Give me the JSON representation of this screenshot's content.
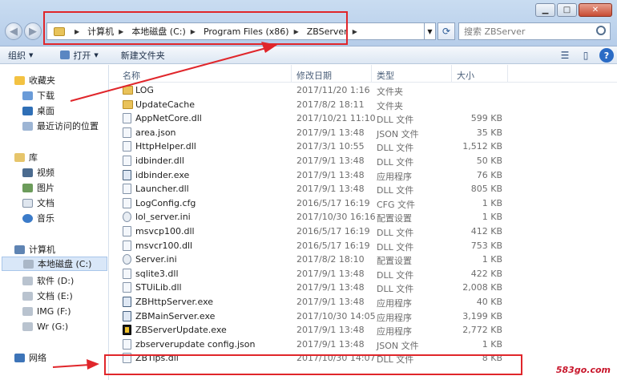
{
  "address": {
    "crumbs": [
      "计算机",
      "本地磁盘 (C:)",
      "Program Files (x86)",
      "ZBServer"
    ],
    "search_placeholder": "搜索 ZBServer"
  },
  "window_controls": {
    "minimize": "▁",
    "maximize": "□",
    "close": "✕"
  },
  "toolbar": {
    "organize": "组织",
    "open": "打开",
    "new_folder": "新建文件夹"
  },
  "nav": {
    "favorites": "收藏夹",
    "downloads": "下载",
    "desktop": "桌面",
    "recent": "最近访问的位置",
    "libraries": "库",
    "videos": "视频",
    "pictures": "图片",
    "documents": "文档",
    "music": "音乐",
    "computer": "计算机",
    "drive_c": "本地磁盘 (C:)",
    "drive_d": "软件 (D:)",
    "drive_e": "文档 (E:)",
    "drive_f": "IMG (F:)",
    "drive_g": "Wr (G:)",
    "network": "网络"
  },
  "columns": {
    "name": "名称",
    "date": "修改日期",
    "type": "类型",
    "size": "大小"
  },
  "files": [
    {
      "name": "LOG",
      "date": "2017/11/20 1:16",
      "type": "文件夹",
      "size": "",
      "icon": "folder"
    },
    {
      "name": "UpdateCache",
      "date": "2017/8/2 18:11",
      "type": "文件夹",
      "size": "",
      "icon": "folder"
    },
    {
      "name": "AppNetCore.dll",
      "date": "2017/10/21 11:10",
      "type": "DLL 文件",
      "size": "599 KB",
      "icon": "file"
    },
    {
      "name": "area.json",
      "date": "2017/9/1 13:48",
      "type": "JSON 文件",
      "size": "35 KB",
      "icon": "file"
    },
    {
      "name": "HttpHelper.dll",
      "date": "2017/3/1 10:55",
      "type": "DLL 文件",
      "size": "1,512 KB",
      "icon": "file"
    },
    {
      "name": "idbinder.dll",
      "date": "2017/9/1 13:48",
      "type": "DLL 文件",
      "size": "50 KB",
      "icon": "file"
    },
    {
      "name": "idbinder.exe",
      "date": "2017/9/1 13:48",
      "type": "应用程序",
      "size": "76 KB",
      "icon": "exe"
    },
    {
      "name": "Launcher.dll",
      "date": "2017/9/1 13:48",
      "type": "DLL 文件",
      "size": "805 KB",
      "icon": "file"
    },
    {
      "name": "LogConfig.cfg",
      "date": "2016/5/17 16:19",
      "type": "CFG 文件",
      "size": "1 KB",
      "icon": "file"
    },
    {
      "name": "lol_server.ini",
      "date": "2017/10/30 16:16",
      "type": "配置设置",
      "size": "1 KB",
      "icon": "gear"
    },
    {
      "name": "msvcp100.dll",
      "date": "2016/5/17 16:19",
      "type": "DLL 文件",
      "size": "412 KB",
      "icon": "file"
    },
    {
      "name": "msvcr100.dll",
      "date": "2016/5/17 16:19",
      "type": "DLL 文件",
      "size": "753 KB",
      "icon": "file"
    },
    {
      "name": "Server.ini",
      "date": "2017/8/2 18:10",
      "type": "配置设置",
      "size": "1 KB",
      "icon": "gear"
    },
    {
      "name": "sqlite3.dll",
      "date": "2017/9/1 13:48",
      "type": "DLL 文件",
      "size": "422 KB",
      "icon": "file"
    },
    {
      "name": "STUiLib.dll",
      "date": "2017/9/1 13:48",
      "type": "DLL 文件",
      "size": "2,008 KB",
      "icon": "file"
    },
    {
      "name": "ZBHttpServer.exe",
      "date": "2017/9/1 13:48",
      "type": "应用程序",
      "size": "40 KB",
      "icon": "exe"
    },
    {
      "name": "ZBMainServer.exe",
      "date": "2017/10/30 14:05",
      "type": "应用程序",
      "size": "3,199 KB",
      "icon": "exe"
    },
    {
      "name": "ZBServerUpdate.exe",
      "date": "2017/9/1 13:48",
      "type": "应用程序",
      "size": "2,772 KB",
      "icon": "zbupd"
    },
    {
      "name": "zbserverupdate config.json",
      "date": "2017/9/1 13:48",
      "type": "JSON 文件",
      "size": "1 KB",
      "icon": "file"
    },
    {
      "name": "ZBTips.dll",
      "date": "2017/10/30 14:07",
      "type": "DLL 文件",
      "size": "8 KB",
      "icon": "file"
    }
  ],
  "watermark": "583go.com",
  "annotation_color": "#e0262b"
}
